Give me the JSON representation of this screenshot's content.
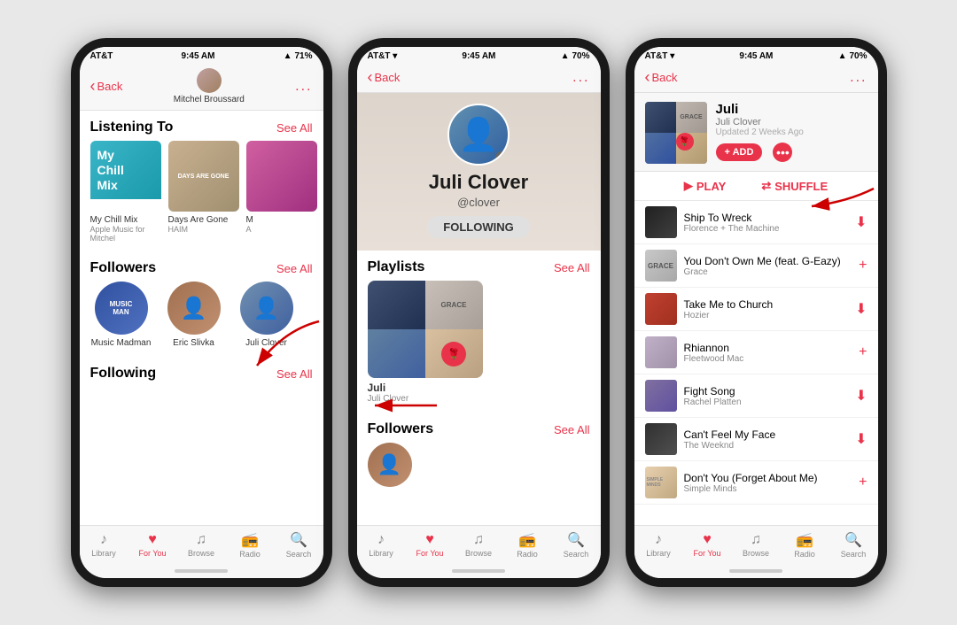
{
  "phone1": {
    "status": {
      "carrier": "AT&T",
      "time": "9:45 AM",
      "battery": "71%"
    },
    "nav": {
      "back": "Back",
      "title": "Mitchel Broussard",
      "more": "..."
    },
    "listening_to": {
      "label": "Listening To",
      "see_all": "See All",
      "albums": [
        {
          "name": "My Chill Mix",
          "artist": "Apple Music for Mitchel",
          "type": "chill"
        },
        {
          "name": "Days Are Gone",
          "artist": "HAIM",
          "type": "haim"
        },
        {
          "name": "M",
          "artist": "A",
          "type": "3"
        }
      ]
    },
    "followers": {
      "label": "Followers",
      "see_all": "See All",
      "people": [
        {
          "name": "Music Madman",
          "type": "music-madman"
        },
        {
          "name": "Eric Slivka",
          "type": "eric"
        },
        {
          "name": "Juli Clover",
          "type": "juli"
        }
      ]
    },
    "following": {
      "label": "Following",
      "see_all": "See All"
    },
    "tabs": [
      {
        "icon": "♪",
        "label": "Library"
      },
      {
        "icon": "♥",
        "label": "For You",
        "active": true
      },
      {
        "icon": "♫",
        "label": "Browse"
      },
      {
        "icon": "📻",
        "label": "Radio"
      },
      {
        "icon": "🔍",
        "label": "Search"
      }
    ]
  },
  "phone2": {
    "status": {
      "carrier": "AT&T",
      "time": "9:45 AM",
      "battery": "70%"
    },
    "nav": {
      "back": "Back",
      "more": "..."
    },
    "profile": {
      "name": "Juli Clover",
      "handle": "@clover",
      "following_btn": "FOLLOWING"
    },
    "playlists": {
      "label": "Playlists",
      "see_all": "See All",
      "items": [
        {
          "title": "Juli",
          "subtitle": "Juli Clover"
        }
      ]
    },
    "followers": {
      "label": "Followers",
      "see_all": "See All"
    },
    "tabs": [
      {
        "icon": "♪",
        "label": "Library"
      },
      {
        "icon": "♥",
        "label": "For You",
        "active": true
      },
      {
        "icon": "♫",
        "label": "Browse"
      },
      {
        "icon": "📻",
        "label": "Radio"
      },
      {
        "icon": "🔍",
        "label": "Search"
      }
    ]
  },
  "phone3": {
    "status": {
      "carrier": "AT&T",
      "time": "9:45 AM",
      "battery": "70%"
    },
    "nav": {
      "back": "Back",
      "more": "..."
    },
    "playlist_header": {
      "title": "Juli",
      "subtitle": "Juli Clover",
      "updated": "Updated 2 Weeks Ago",
      "add_btn": "+ ADD",
      "more_btn": "•••"
    },
    "controls": {
      "play": "PLAY",
      "shuffle": "SHUFFLE"
    },
    "tracks": [
      {
        "name": "Ship To Wreck",
        "artist": "Florence + The Machine",
        "action": "cloud",
        "thumb": "tr1"
      },
      {
        "name": "You Don't Own Me (feat. G-Eazy)",
        "artist": "Grace",
        "action": "plus",
        "thumb": "tr2"
      },
      {
        "name": "Take Me to Church",
        "artist": "Hozier",
        "action": "cloud",
        "thumb": "tr3"
      },
      {
        "name": "Rhiannon",
        "artist": "Fleetwood Mac",
        "action": "plus",
        "thumb": "tr4"
      },
      {
        "name": "Fight Song",
        "artist": "Rachel Platten",
        "action": "cloud",
        "thumb": "tr5"
      },
      {
        "name": "Can't Feel My Face",
        "artist": "The Weeknd",
        "action": "cloud",
        "thumb": "tr6"
      },
      {
        "name": "Don't You (Forget About Me)",
        "artist": "Simple Minds",
        "action": "plus",
        "thumb": "tr7"
      }
    ],
    "tabs": [
      {
        "icon": "♪",
        "label": "Library"
      },
      {
        "icon": "♥",
        "label": "For You",
        "active": true
      },
      {
        "icon": "♫",
        "label": "Browse"
      },
      {
        "icon": "📻",
        "label": "Radio"
      },
      {
        "icon": "🔍",
        "label": "Search"
      }
    ]
  }
}
